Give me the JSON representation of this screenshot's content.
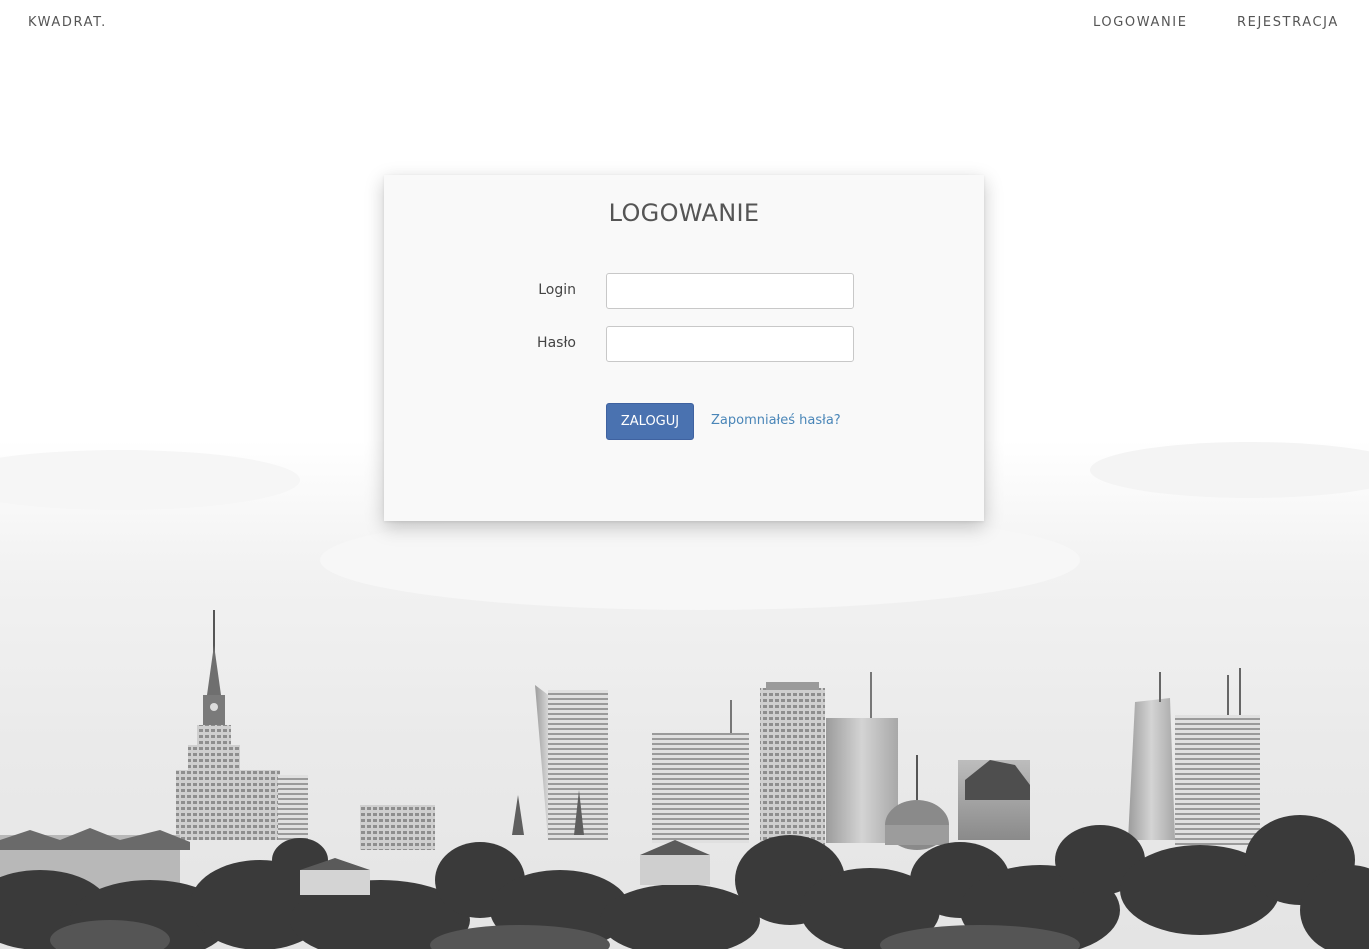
{
  "header": {
    "brand": "KWADRAT.",
    "nav": {
      "login": "LOGOWANIE",
      "register": "REJESTRACJA"
    }
  },
  "login_form": {
    "title": "LOGOWANIE",
    "login_label": "Login",
    "login_value": "",
    "password_label": "Hasło",
    "password_value": "",
    "submit_label": "ZALOGUJ",
    "forgot_label": "Zapomniałeś hasła?"
  },
  "colors": {
    "primary_button": "#4a72b0",
    "link": "#4a86b8",
    "text": "#555555",
    "card_background": "#f9f9f9"
  },
  "background": {
    "image": "city-skyline"
  }
}
